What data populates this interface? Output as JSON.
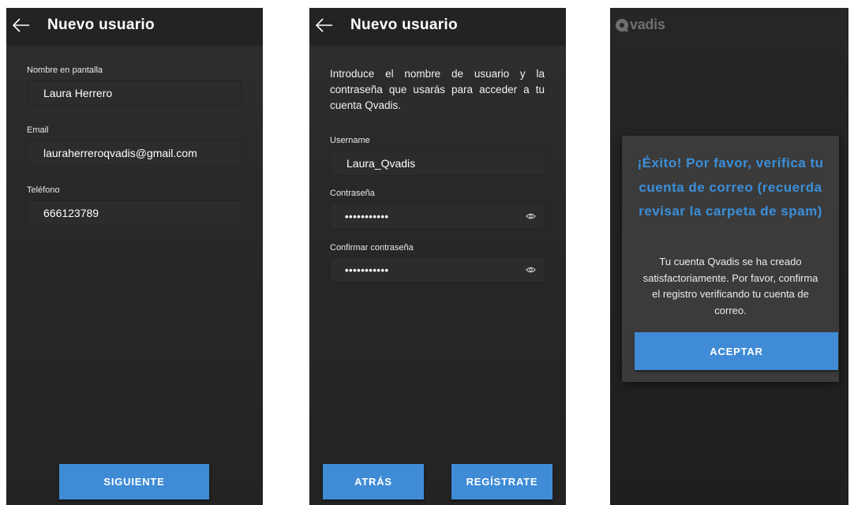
{
  "screen1": {
    "header_title": "Nuevo usuario",
    "fields": [
      {
        "label": "Nombre en pantalla",
        "value": "Laura Herrero"
      },
      {
        "label": "Email",
        "value": "lauraherreroqvadis@gmail.com"
      },
      {
        "label": "Teléfono",
        "value": "666123789"
      }
    ],
    "next_button": "SIGUIENTE"
  },
  "screen2": {
    "header_title": "Nuevo usuario",
    "intro": "Introduce el nombre de usuario y la contraseña que usarás para acceder a tu cuenta Qvadis.",
    "username_label": "Username",
    "username_value": "Laura_Qvadis",
    "password_label": "Contraseña",
    "password_value": "•••••••••••",
    "confirm_label": "Confirmar contraseña",
    "confirm_value": "•••••••••••",
    "back_button": "ATRÁS",
    "register_button": "REGÍSTRATE"
  },
  "screen3": {
    "logo_text": "vadis",
    "dialog_title": "¡Éxito! Por favor, verifica tu cuenta de correo (recuerda revisar la carpeta de spam)",
    "dialog_body": "Tu cuenta Qvadis se ha creado satisfactoriamente. Por favor, confirma el registro verificando tu cuenta de correo.",
    "accept_button": "ACEPTAR"
  },
  "colors": {
    "accent": "#3f8bd6",
    "dialog_title": "#3b8fd9",
    "screen_bg": "#2a2a2a",
    "field_bg": "#2c2c2c"
  }
}
